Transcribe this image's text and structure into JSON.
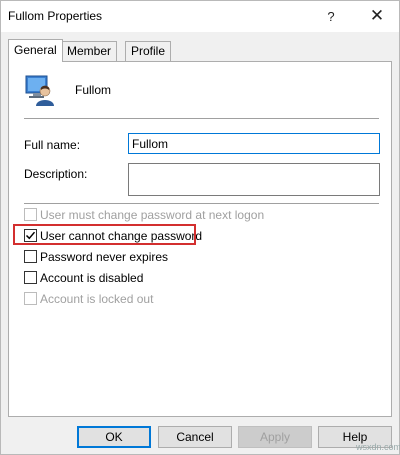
{
  "window": {
    "title": "Fullom Properties",
    "help_glyph": "?",
    "close_glyph": "✕"
  },
  "tabs": [
    {
      "label": "General",
      "active": true
    },
    {
      "label": "Member Of",
      "active": false
    },
    {
      "label": "Profile",
      "active": false
    }
  ],
  "general": {
    "user_name": "Fullom",
    "full_name_label": "Full name:",
    "full_name_value": "Fullom",
    "description_label": "Description:",
    "description_value": "",
    "options": [
      {
        "label": "User must change password at next logon",
        "checked": false,
        "enabled": false
      },
      {
        "label": "User cannot change password",
        "checked": true,
        "enabled": true
      },
      {
        "label": "Password never expires",
        "checked": false,
        "enabled": true
      },
      {
        "label": "Account is disabled",
        "checked": false,
        "enabled": true
      },
      {
        "label": "Account is locked out",
        "checked": false,
        "enabled": false
      }
    ]
  },
  "buttons": {
    "ok": "OK",
    "cancel": "Cancel",
    "apply": "Apply",
    "help": "Help"
  },
  "watermark": "wsxdn.com",
  "colors": {
    "highlight": "#d32f2f",
    "focus": "#0078d7"
  }
}
